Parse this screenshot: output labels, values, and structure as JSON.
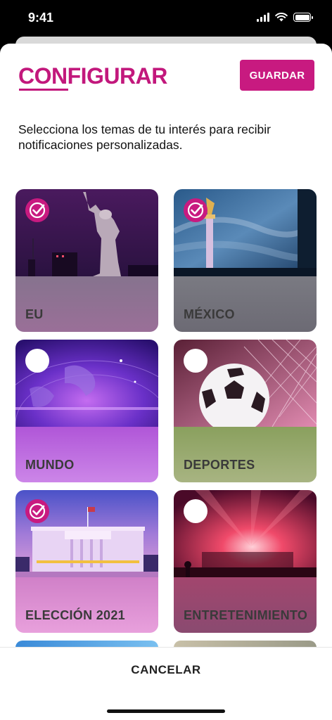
{
  "status": {
    "time": "9:41"
  },
  "header": {
    "title": "CONFIGURAR",
    "save_label": "GUARDAR"
  },
  "description": "Selecciona los temas de tu interés para recibir notificaciones personalizadas.",
  "topics": [
    {
      "label": "EU",
      "selected": true,
      "icon": "statue-of-liberty-image"
    },
    {
      "label": "MÉXICO",
      "selected": true,
      "icon": "angel-independence-image"
    },
    {
      "label": "MUNDO",
      "selected": false,
      "icon": "globe-image"
    },
    {
      "label": "DEPORTES",
      "selected": false,
      "icon": "soccer-ball-image"
    },
    {
      "label": "ELECCIÓN 2021",
      "selected": true,
      "icon": "white-house-image"
    },
    {
      "label": "ENTRETENIMIENTO",
      "selected": false,
      "icon": "concert-image"
    }
  ],
  "footer": {
    "cancel_label": "CANCELAR"
  },
  "colors": {
    "accent": "#c81a80"
  }
}
